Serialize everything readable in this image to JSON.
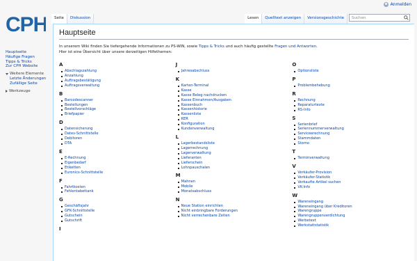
{
  "logo_text": "CPH",
  "personal": {
    "login_label": "Anmelden"
  },
  "tabs_left": [
    {
      "label": "Seite",
      "selected": true
    },
    {
      "label": "Diskussion",
      "selected": false
    }
  ],
  "tabs_right": [
    {
      "label": "Lesen",
      "selected": true
    },
    {
      "label": "Quelltext anzeigen",
      "selected": false
    },
    {
      "label": "Versionsgeschichte",
      "selected": false
    }
  ],
  "search": {
    "placeholder": "Suchen"
  },
  "sidebar": {
    "nav": [
      "Hauptseite",
      "Häufige Fragen",
      "Tipps & Tricks",
      "Zur CPH Website"
    ],
    "portlets": [
      {
        "title": "Weitere Elemente",
        "expanded": true,
        "items": [
          "Letzte Änderungen",
          "Zufällige Seite"
        ]
      },
      {
        "title": "Werkzeuge",
        "expanded": false,
        "items": []
      }
    ]
  },
  "content": {
    "title": "Hauptseite",
    "intro": {
      "before": "In unserem Wiki finden Sie tiefergehende Informationen zu PS-WIN, sowie ",
      "link1": "Tipps & Tricks",
      "middle": " und auch häufig gestellte ",
      "link2": "Fragen und Antworten",
      "after": "."
    },
    "overview": "Hier ist eine Übersicht über unsere derzeitigen Hilfethemen:",
    "columns": [
      [
        {
          "letter": "A",
          "items": [
            "Abschlagszahlung",
            "Anzahlung",
            "Auftragsbestätigung",
            "Auftragsverwaltung"
          ]
        },
        {
          "letter": "B",
          "items": [
            "Barcodescanner",
            "Bestellungen",
            "Bestellvorschläge",
            "Briefpapier"
          ]
        },
        {
          "letter": "D",
          "items": [
            "Datensicherung",
            "Datev-Schnittstelle",
            "Debitoren",
            "DTA"
          ]
        },
        {
          "letter": "E",
          "items": [
            "E-Rechnung",
            "Eigenbedarf",
            "Etiketten",
            "Euronics-Schnittstelle"
          ]
        },
        {
          "letter": "F",
          "items": [
            "Fahrtkosten",
            "Fehlentabettank"
          ]
        },
        {
          "letter": "G",
          "items": [
            "Geschäftsjahr",
            "GFK-Schnittstelle",
            "Gutschein",
            "Gutschrift"
          ]
        },
        {
          "letter": "I",
          "items": []
        }
      ],
      [
        {
          "letter": "J",
          "items": [
            "Jahresabschluss"
          ]
        },
        {
          "letter": "K",
          "items": [
            "Karten-Terminal",
            "Kasse",
            "Kasse Beleg nachdrucken",
            "Kasse Einnahmen/Ausgaben",
            "Kassenbuch",
            "Kassenhistorie",
            "Kassenliste",
            "KER",
            "Konfiguration",
            "Kundenverwaltung"
          ]
        },
        {
          "letter": "L",
          "items": [
            "Lagerbestandsliste",
            "Lagerrechnung",
            "Lagerverwaltung",
            "Lieferanten",
            "Lieferschein",
            "Lohnpauschalen"
          ]
        },
        {
          "letter": "M",
          "items": [
            "Mahnen",
            "Mobile",
            "Monatsabschluss"
          ]
        },
        {
          "letter": "N",
          "items": [
            "Neue Station einrichten",
            "Nicht einbringbare Forderungen",
            "Nicht verrechenbare Zeiten"
          ]
        }
      ],
      [
        {
          "letter": "O",
          "items": [
            "Optionsliste"
          ]
        },
        {
          "letter": "P",
          "items": [
            "Problembehebung"
          ]
        },
        {
          "letter": "R",
          "items": [
            "Rechnung",
            "Reparaturtexte",
            "RS-Info"
          ]
        },
        {
          "letter": "S",
          "items": [
            "Serienbrief",
            "Seriennummerverwaltung",
            "Serviceerechnung",
            "Stammdaten",
            "Storno"
          ]
        },
        {
          "letter": "T",
          "items": [
            "Terminverwaltung"
          ]
        },
        {
          "letter": "V",
          "items": [
            "Verkäufer-Provision",
            "Verkäufer-Statistik",
            "Verkaufte Artikel suchen",
            "VK-Info"
          ]
        },
        {
          "letter": "W",
          "items": [
            "Wareneingang",
            "Wareneingang über Kreditoren",
            "Warengruppe",
            "Warengruppenverdichtung",
            "Werbetext",
            "Werkstattstatistik"
          ]
        }
      ]
    ]
  },
  "colors": {
    "logo": "#1f63a8",
    "link": "#0645ad",
    "border": "#a7d7f9"
  }
}
